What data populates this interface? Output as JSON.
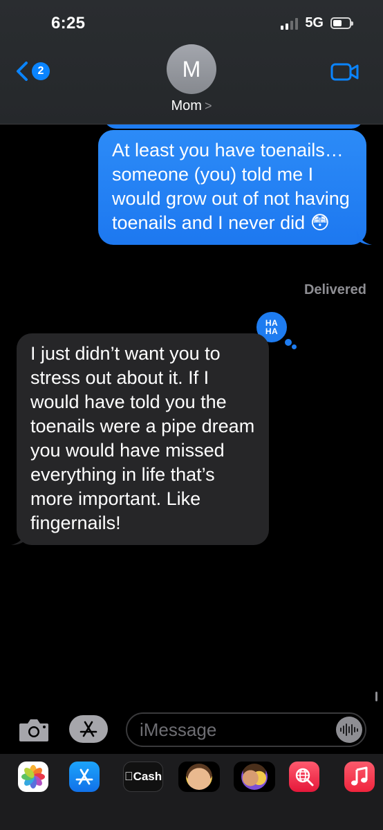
{
  "status_bar": {
    "time": "6:25",
    "network": "5G",
    "battery_level": 0.55
  },
  "header": {
    "back_badge": "2",
    "avatar_initial": "M",
    "contact_name": "Mom",
    "contact_chevron": ">"
  },
  "messages": [
    {
      "direction": "outgoing",
      "text": "At least you have toenails… someone (you) told me I would grow out of not having toenails and I never did 😳",
      "status": "Delivered"
    },
    {
      "direction": "incoming",
      "text": "I just didn’t want you to stress out about it. If I would have told you the toenails were a pipe dream you would have missed everything in life that’s more important. Like fingernails!",
      "tapback": {
        "line1": "HA",
        "line2": "HA"
      }
    }
  ],
  "composer": {
    "placeholder": "iMessage"
  },
  "drawer": {
    "apps": [
      {
        "name": "Photos"
      },
      {
        "name": "App Store"
      },
      {
        "name": "Apple Cash",
        "label": "Cash"
      },
      {
        "name": "Memoji"
      },
      {
        "name": "Memoji Stickers"
      },
      {
        "name": "Search"
      },
      {
        "name": "Music"
      }
    ]
  },
  "colors": {
    "accent": "#0A84FF",
    "outgoing_bubble": "#1E7CF0",
    "incoming_bubble": "#262628",
    "muted_text": "#8E8E93"
  }
}
